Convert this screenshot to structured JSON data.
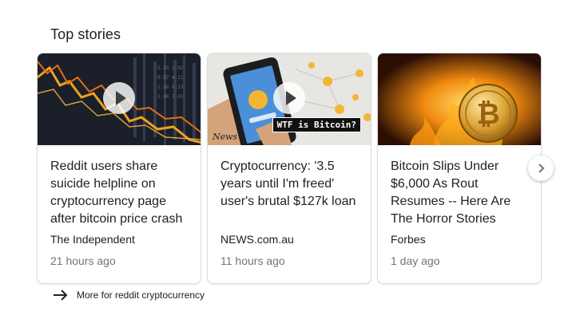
{
  "section": {
    "title": "Top stories"
  },
  "stories": [
    {
      "headline": "Reddit users share suicide helpline on cryptocurrency page after bitcoin price crash",
      "publisher": "The Independent",
      "time": "21 hours ago",
      "has_video": true
    },
    {
      "headline": "Cryptocurrency: '3.5 years until I'm freed' user's brutal $127k loan",
      "publisher": "NEWS.com.au",
      "time": "11 hours ago",
      "has_video": true,
      "thumb_caption": "WTF is Bitcoin?",
      "thumb_watermark": "News"
    },
    {
      "headline": "Bitcoin Slips Under $6,000 As Rout Resumes -- Here Are The Horror Stories",
      "publisher": "Forbes",
      "time": "1 day ago",
      "has_video": false
    }
  ],
  "more": {
    "label": "More for reddit cryptocurrency"
  },
  "icons": {
    "next": "chevron-right-icon",
    "more": "arrow-right-icon",
    "play": "play-icon"
  },
  "colors": {
    "text": "#202124",
    "secondary": "#70757a",
    "border": "#dadce0"
  }
}
